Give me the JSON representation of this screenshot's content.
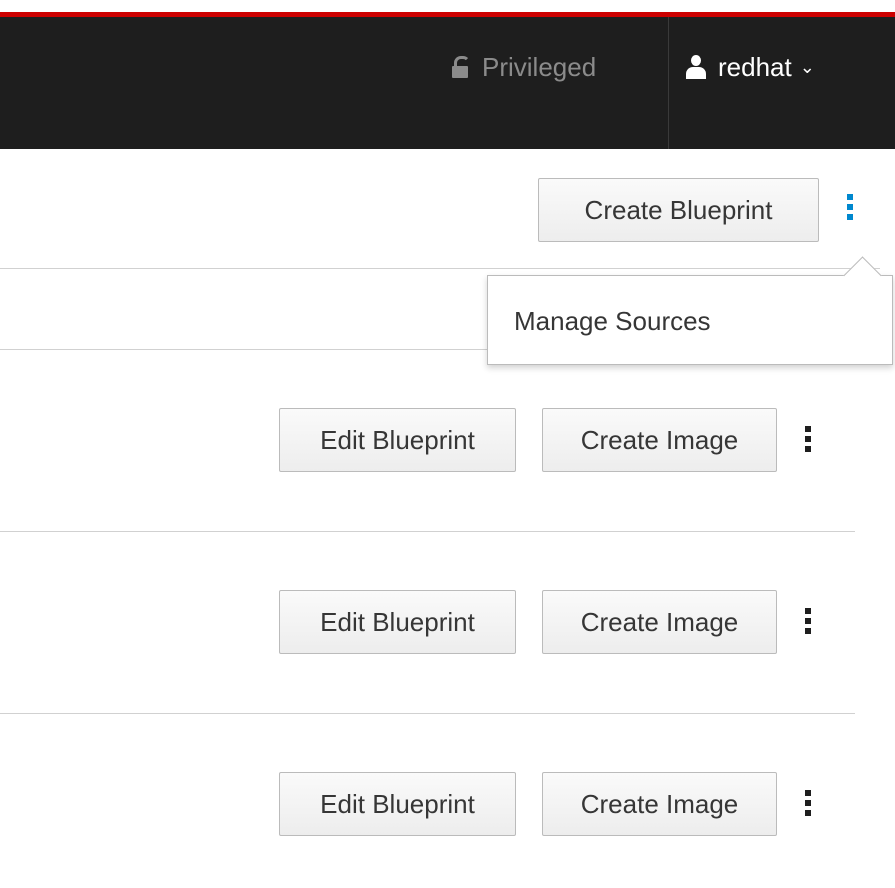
{
  "masthead": {
    "privileged_label": "Privileged",
    "user_name": "redhat",
    "lock_icon": "unlock-icon",
    "user_icon": "user-icon",
    "caret_icon": "chevron-down-icon",
    "accent_color": "#cc0000",
    "background_color": "#1e1e1e"
  },
  "toolbar": {
    "create_blueprint_label": "Create Blueprint",
    "kebab_icon": "kebab-icon"
  },
  "dropdown": {
    "items": [
      {
        "label": "Manage Sources"
      }
    ]
  },
  "blueprint_rows": [
    {
      "edit_label": "Edit Blueprint",
      "create_label": "Create Image"
    },
    {
      "edit_label": "Edit Blueprint",
      "create_label": "Create Image"
    },
    {
      "edit_label": "Edit Blueprint",
      "create_label": "Create Image"
    }
  ]
}
